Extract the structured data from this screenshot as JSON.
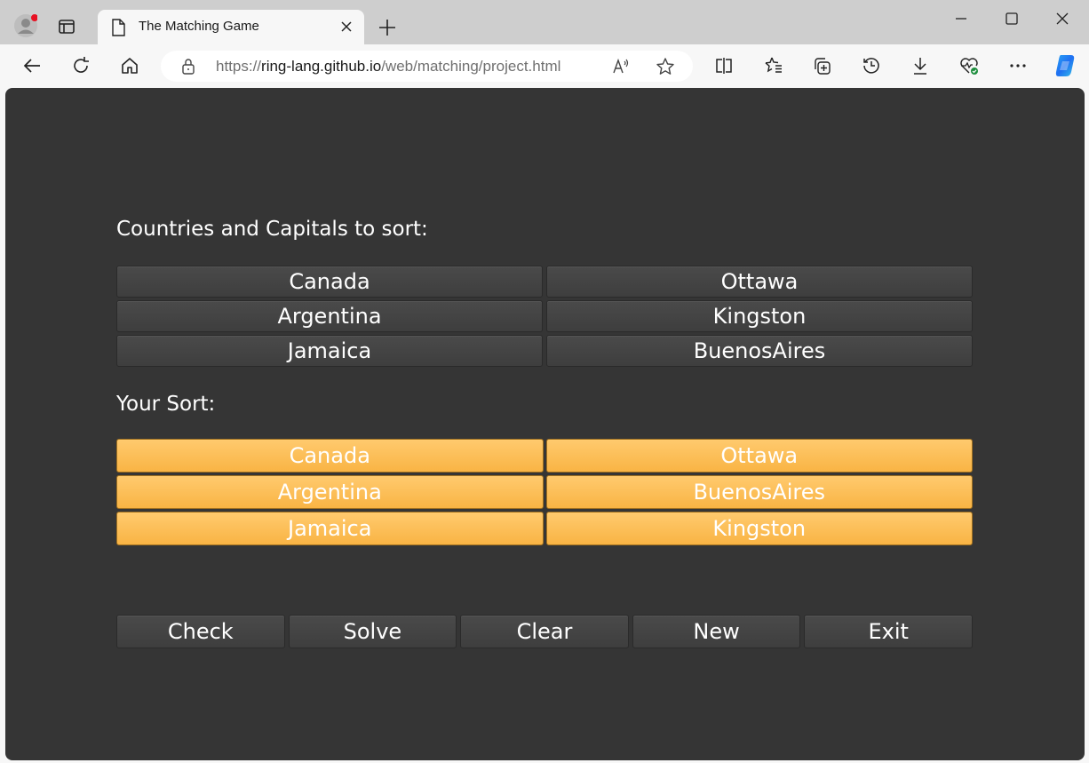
{
  "browser": {
    "tab": {
      "title": "The Matching Game"
    },
    "address_bar": {
      "url_prefix": "https://",
      "url_host": "ring-lang.github.io",
      "url_path": "/web/matching/project.html"
    },
    "icons": {
      "profile": "profile-avatar-icon",
      "tab_actions": "tab-actions-icon",
      "new_tab": "plus-icon",
      "minimize": "minimize-icon",
      "maximize": "maximize-icon",
      "close": "close-icon",
      "back": "back-arrow-icon",
      "refresh": "refresh-icon",
      "home": "home-icon",
      "lock": "lock-icon",
      "read_aloud": "read-aloud-icon",
      "favorite": "star-icon",
      "split_screen": "split-screen-icon",
      "favorites": "favorites-icon",
      "collections": "collections-icon",
      "history": "history-icon",
      "downloads": "download-icon",
      "browser_essentials": "heart-pulse-icon",
      "more": "more-icon",
      "copilot": "copilot-icon"
    }
  },
  "game": {
    "source_label": "Countries and Capitals to sort:",
    "source_items": [
      [
        "Canada",
        "Ottawa"
      ],
      [
        "Argentina",
        "Kingston"
      ],
      [
        "Jamaica",
        "BuenosAires"
      ]
    ],
    "sort_label": "Your Sort:",
    "sorted_items": [
      [
        "Canada",
        "Ottawa"
      ],
      [
        "Argentina",
        "BuenosAires"
      ],
      [
        "Jamaica",
        "Kingston"
      ]
    ],
    "buttons": {
      "check": "Check",
      "solve": "Solve",
      "clear": "Clear",
      "new": "New",
      "exit": "Exit"
    },
    "colors": {
      "background": "#353535",
      "tile": "#444444",
      "sorted_tile": "#fbbd55"
    }
  }
}
